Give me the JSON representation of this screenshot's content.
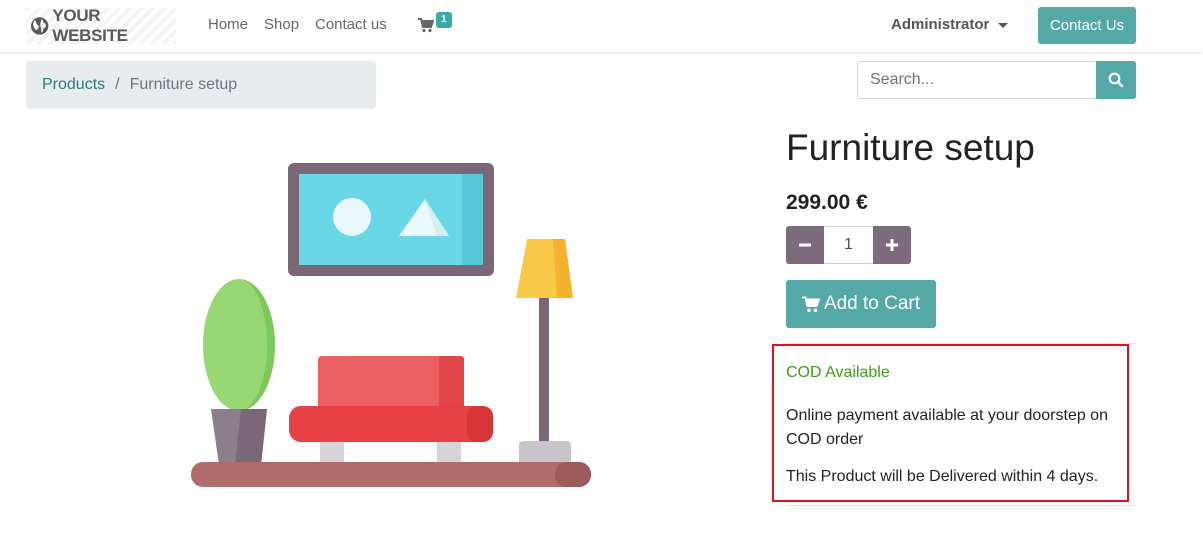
{
  "header": {
    "brand": "YOUR WEBSITE",
    "nav": [
      "Home",
      "Shop",
      "Contact us"
    ],
    "cart_count": "1",
    "user": "Administrator",
    "contact_button": "Contact Us"
  },
  "breadcrumb": {
    "parent": "Products",
    "separator": "/",
    "current": "Furniture setup"
  },
  "search": {
    "placeholder": "Search..."
  },
  "product": {
    "name": "Furniture setup",
    "price": "299.00 €",
    "quantity": "1",
    "add_to_cart": "Add to Cart"
  },
  "info": {
    "cod": "COD Available",
    "online_payment": "Online payment available at your doorstep on COD order",
    "delivery": "This Product will be Delivered within 4 days."
  },
  "colors": {
    "primary": "#52a9a5",
    "secondary": "#7c6b7c",
    "cod_green": "#3f9a1a",
    "highlight_border": "#e00f22"
  },
  "icons": [
    "globe-icon",
    "cart-icon",
    "caret-down-icon",
    "search-icon",
    "minus-icon",
    "plus-icon"
  ]
}
